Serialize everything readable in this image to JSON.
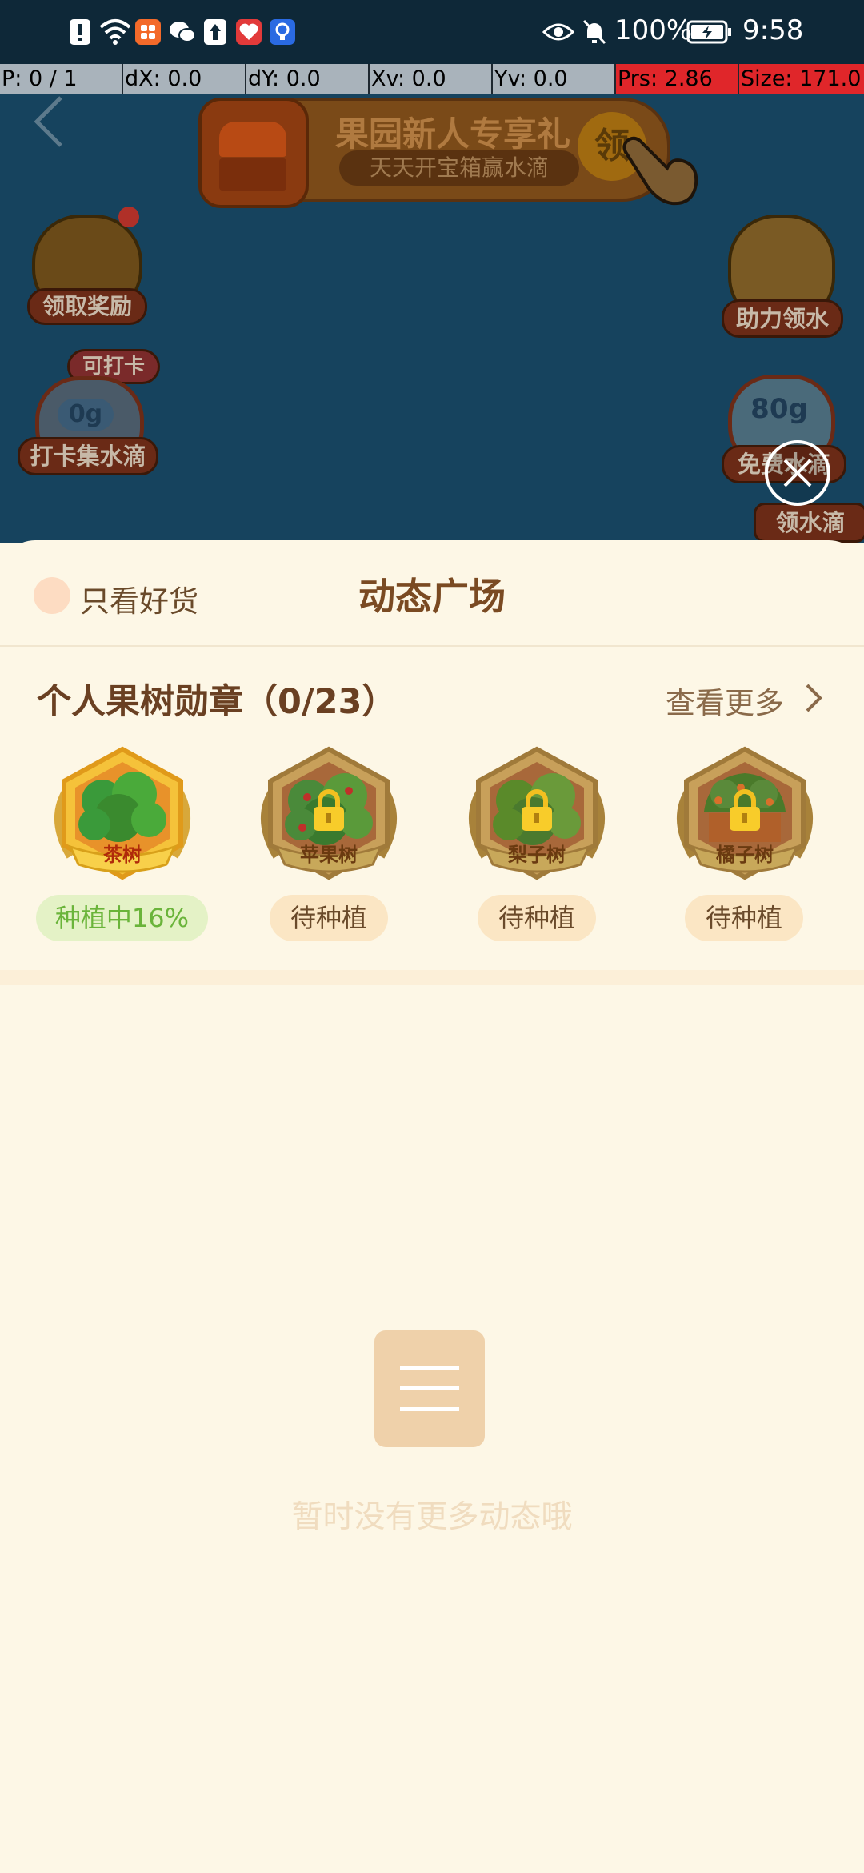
{
  "status_bar": {
    "battery": "100%",
    "time": "9:58"
  },
  "pointer_info": {
    "p": "P: 0 / 1",
    "dx": "dX: 0.0",
    "dy": "dY: 0.0",
    "xv": "Xv: 0.0",
    "yv": "Yv: 0.0",
    "prs": "Prs: 2.86",
    "size": "Size: 171.0"
  },
  "game": {
    "banner_title": "果园新人专享礼",
    "banner_subtitle": "天天开宝箱赢水滴",
    "banner_claim": "领",
    "claim_reward": "领取奖励",
    "checkin_tag": "可打卡",
    "checkin_amount": "0g",
    "checkin_label": "打卡集水滴",
    "help_water": "助力领水",
    "free_amount": "80g",
    "free_water": "免费水滴",
    "collect_water": "领水滴"
  },
  "sheet": {
    "filter_label": "只看好货",
    "title": "动态广场",
    "medals_heading": "个人果树勋章（0/23）",
    "see_more": "查看更多",
    "medals": [
      {
        "name": "茶树",
        "status": "种植中16%",
        "locked": false
      },
      {
        "name": "苹果树",
        "status": "待种植",
        "locked": true
      },
      {
        "name": "梨子树",
        "status": "待种植",
        "locked": true
      },
      {
        "name": "橘子树",
        "status": "待种植",
        "locked": true
      }
    ],
    "empty_text": "暂时没有更多动态哦"
  },
  "colors": {
    "sheet_bg": "#fdf7e6",
    "heading_brown": "#7a4a22",
    "accent_orange": "#f3a23a",
    "growing_green": "#6ab43a",
    "pill_cream": "#fbe6c4",
    "empty_icon": "#efd1aa"
  },
  "icons": [
    "back-arrow-icon",
    "close-icon",
    "chevron-right-icon",
    "lock-icon",
    "list-icon",
    "eye-icon",
    "bell-off-icon",
    "battery-icon",
    "wifi-icon"
  ]
}
